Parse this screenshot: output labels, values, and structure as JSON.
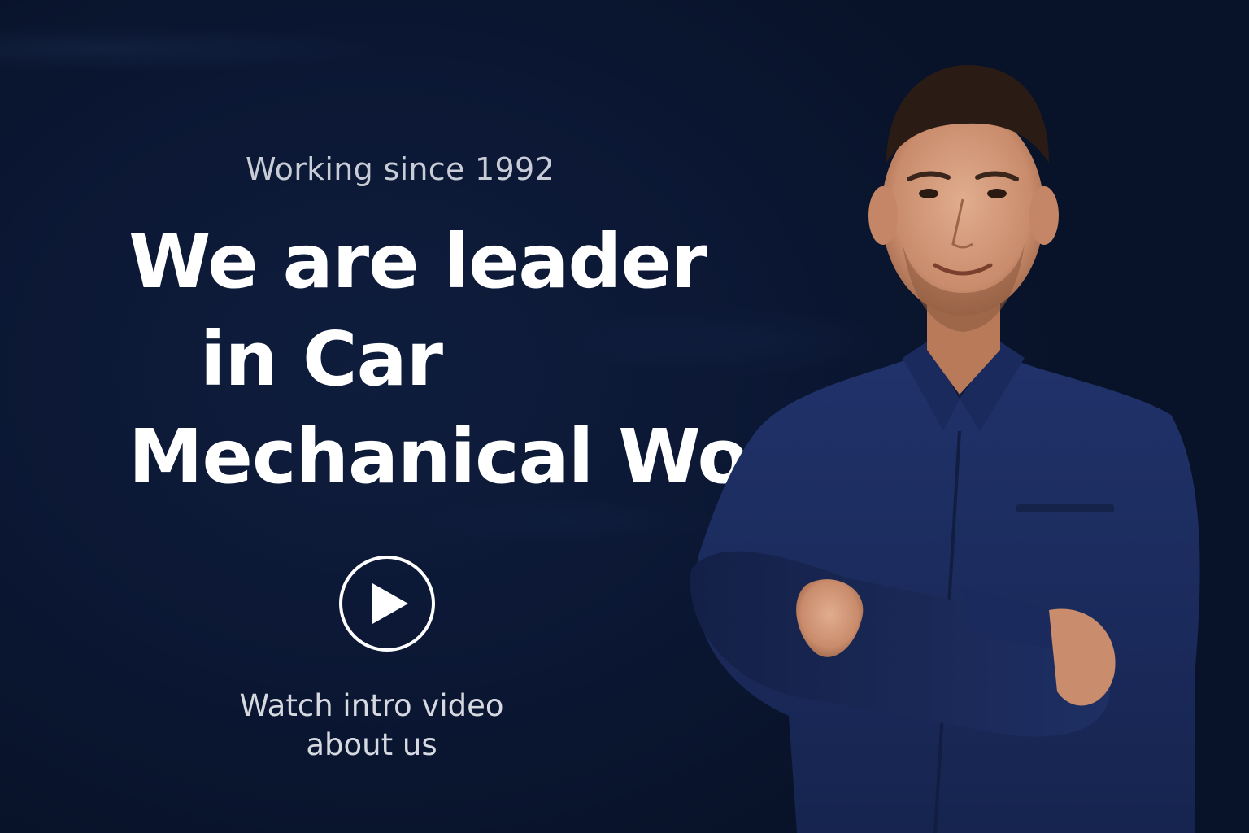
{
  "hero": {
    "eyebrow": "Working since 1992",
    "headline": {
      "line1": "We are leader",
      "line2": "in Car",
      "line3": "Mechanical Work"
    },
    "video": {
      "button_icon": "play-icon",
      "caption_line1": "Watch intro video",
      "caption_line2": "about us"
    },
    "image_subject": "mechanic-portrait"
  },
  "colors": {
    "background": "#0b1630",
    "headline": "#ffffff",
    "eyebrow": "#c7ccd6",
    "shirt": "#1b2b5e"
  }
}
